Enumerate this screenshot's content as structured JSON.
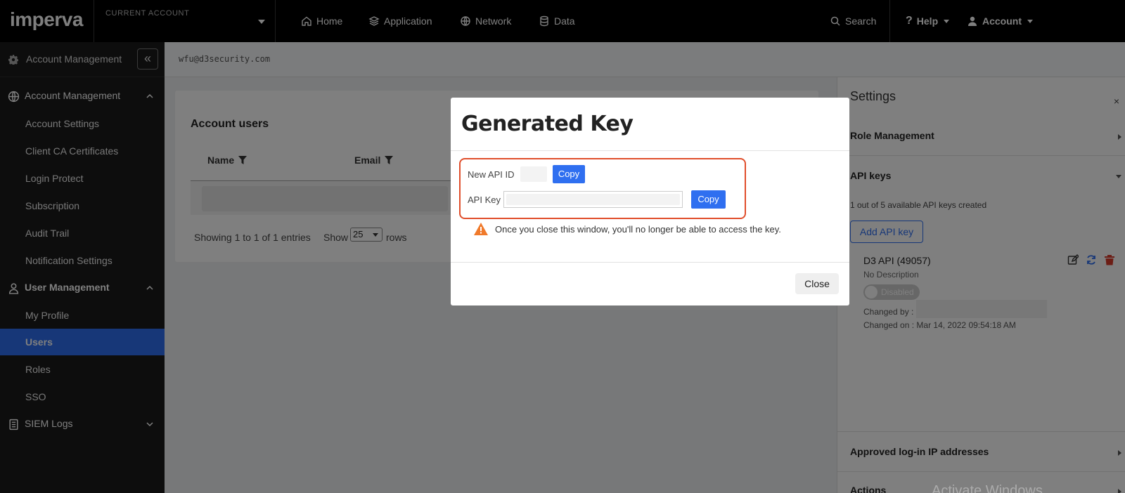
{
  "brand": {
    "logo": "imperva"
  },
  "topbar": {
    "account_label": "CURRENT ACCOUNT",
    "nav": [
      "Home",
      "Application",
      "Network",
      "Data"
    ],
    "search": "Search",
    "help": "Help",
    "account": "Account"
  },
  "sidebar": {
    "header_title": "Account Management",
    "collapse_symbol": "«",
    "groups": [
      {
        "label": "Account Management",
        "items": [
          "Account Settings",
          "Client CA Certificates",
          "Login Protect",
          "Subscription",
          "Audit Trail",
          "Notification Settings"
        ]
      },
      {
        "label": "User Management",
        "items": [
          "My Profile",
          "Users",
          "Roles",
          "SSO"
        ]
      },
      {
        "label": "SIEM Logs",
        "items": []
      }
    ],
    "active_item": "Users"
  },
  "breadcrumb": {
    "email": "wfu@d3security.com"
  },
  "account_users": {
    "title": "Account users",
    "columns": [
      "Name",
      "Email"
    ],
    "showing": "Showing 1 to 1 of 1 entries",
    "show_label": "Show",
    "rows_value": "25",
    "rows_label": "rows"
  },
  "settings": {
    "title": "Settings",
    "close_symbol": "×",
    "sections": {
      "role_management": "Role Management",
      "api_keys": "API keys",
      "approved_ips": "Approved log-in IP addresses",
      "actions": "Actions"
    },
    "api_keys_info": "1 out of 5 available API keys created",
    "add_key_button": "Add API key",
    "key": {
      "name": "D3 API (49057)",
      "description": "No Description",
      "status": "Disabled",
      "changed_by_label": "Changed by :",
      "changed_on": "Changed on : Mar 14, 2022 09:54:18 AM"
    }
  },
  "modal": {
    "title": "Generated Key",
    "new_api_id_label": "New API ID",
    "api_key_label": "API Key",
    "copy_label": "Copy",
    "warning": "Once you close this window, you'll no longer be able to access the key.",
    "close_label": "Close"
  },
  "watermark": "Activate Windows",
  "colors": {
    "accent": "#2f6ff0",
    "highlight": "#e04e2b",
    "warning": "#f07a2b",
    "topbar": "#000000",
    "sidebar": "#1b1b1b"
  }
}
